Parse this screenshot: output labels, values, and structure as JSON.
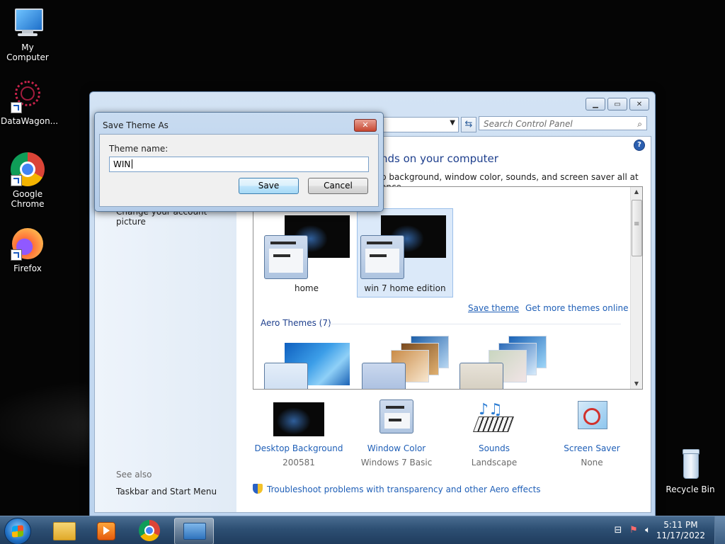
{
  "desktop": {
    "icons": [
      {
        "label": "My Computer"
      },
      {
        "label": "DataWagon..."
      },
      {
        "label": "Google Chrome"
      },
      {
        "label": "Firefox"
      },
      {
        "label": "Recycle Bin"
      }
    ]
  },
  "control_panel": {
    "search_placeholder": "Search Control Panel",
    "heading": "nds on your computer",
    "subheading": "p background, window color, sounds, and screen saver all at once.",
    "left_pane": {
      "account_link": "Change your account picture",
      "see_also": "See also",
      "taskbar_link": "Taskbar and Start Menu"
    },
    "my_themes": [
      {
        "label": "home"
      },
      {
        "label": "win 7 home edition"
      }
    ],
    "save_theme_link": "Save theme",
    "get_more_link": "Get more themes online",
    "aero_section": "Aero Themes (7)",
    "options": [
      {
        "title": "Desktop Background",
        "sub": "200581"
      },
      {
        "title": "Window Color",
        "sub": "Windows 7 Basic"
      },
      {
        "title": "Sounds",
        "sub": "Landscape"
      },
      {
        "title": "Screen Saver",
        "sub": "None"
      }
    ],
    "troubleshoot_link": "Troubleshoot problems with transparency and other Aero effects"
  },
  "dialog": {
    "title": "Save Theme As",
    "label": "Theme name:",
    "value": "WIN",
    "save": "Save",
    "cancel": "Cancel",
    "close_glyph": "✕"
  },
  "taskbar": {
    "time": "5:11 PM",
    "date": "11/17/2022"
  },
  "icons": {
    "search": "search-icon",
    "help": "help-icon",
    "refresh": "refresh-icon",
    "shield": "shield-icon"
  },
  "colors": {
    "link": "#1f5fb7",
    "heading": "#1e3f8d",
    "taskbar": "#2d4f73",
    "close_button": "#c74731"
  }
}
